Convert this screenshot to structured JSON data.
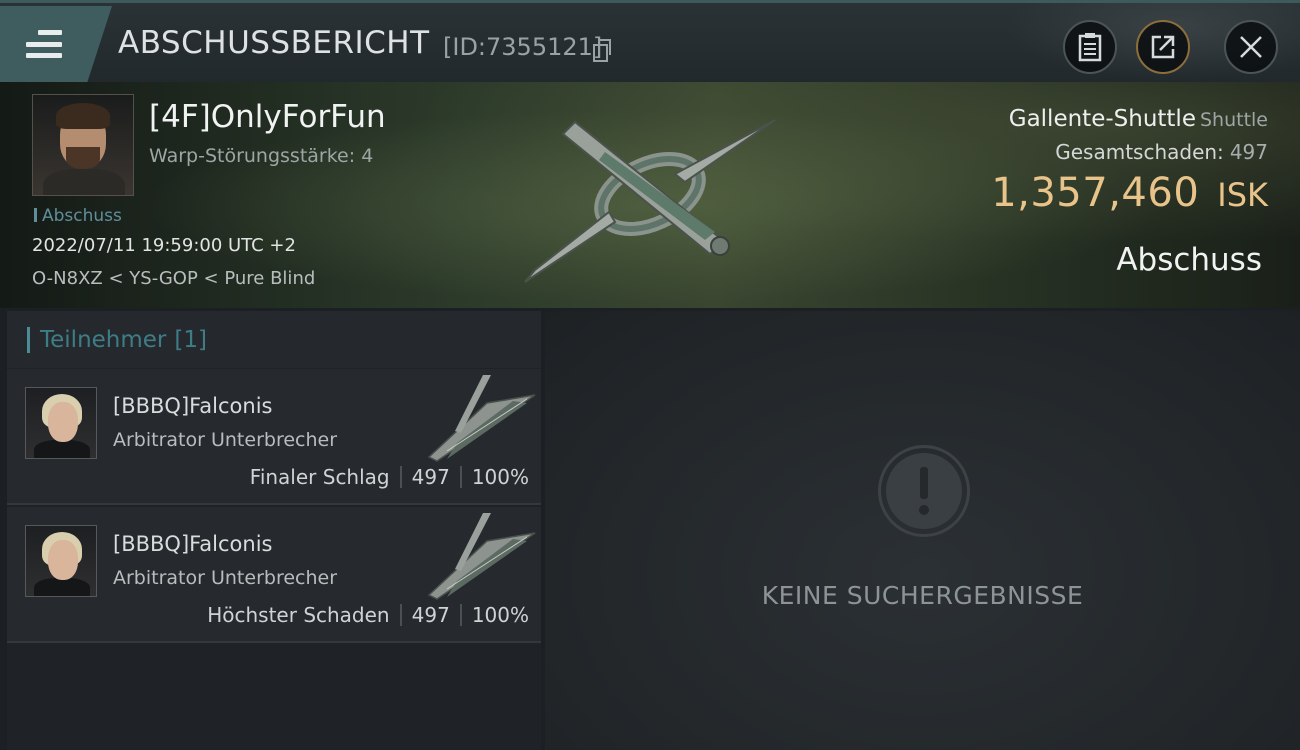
{
  "header": {
    "title": "ABSCHUSSBERICHT",
    "report_id": "[ID:7355121]",
    "icons": [
      "menu-icon",
      "copy-icon",
      "clipboard-icon",
      "share-icon",
      "close-icon"
    ]
  },
  "victim": {
    "name": "[4F]OnlyForFun",
    "warp_disruption": "Warp-Störungsstärke: 4",
    "kill_tag": "Abschuss",
    "datetime": "2022/07/11 19:59:00 UTC +2",
    "location": "O-N8XZ < YS-GOP < Pure Blind",
    "ship_name": "Gallente-Shuttle",
    "ship_class": "Shuttle",
    "total_damage_label": "Gesamtschaden:",
    "total_damage": "497",
    "isk_value": "1,357,460",
    "isk_unit": "ISK",
    "result": "Abschuss"
  },
  "participants": {
    "label": "Teilnehmer",
    "count": "[1]",
    "rows": [
      {
        "name": "[BBBQ]Falconis",
        "ship": "Arbitrator Unterbrecher",
        "role": "Finaler Schlag",
        "damage": "497",
        "percent": "100%"
      },
      {
        "name": "[BBBQ]Falconis",
        "ship": "Arbitrator Unterbrecher",
        "role": "Höchster Schaden",
        "damage": "497",
        "percent": "100%"
      }
    ]
  },
  "results_panel": {
    "empty_message": "KEINE SUCHERGEBNISSE"
  },
  "colors": {
    "accent_teal": "#3f5d5e",
    "isk_gold": "#e9c48a",
    "participants_teal": "#3f7d86",
    "share_ring": "#8b6e3c"
  }
}
